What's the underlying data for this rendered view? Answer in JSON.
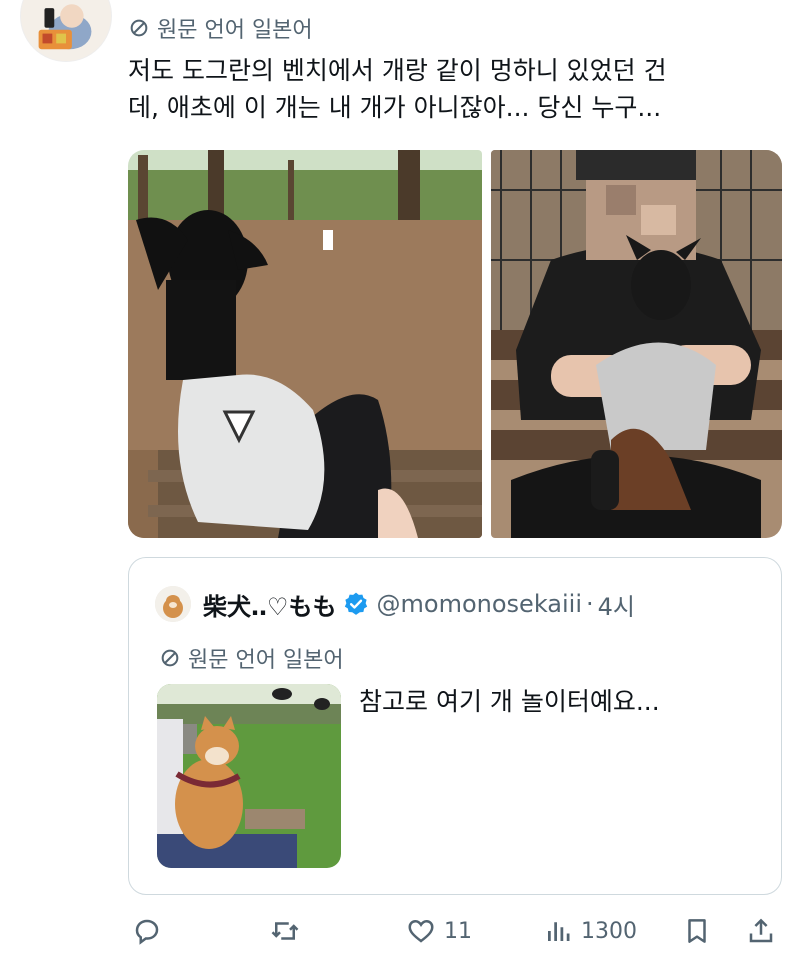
{
  "post": {
    "translate_label": "원문 언어 일본어",
    "text_lines": [
      "저도 도그란의 벤치에서 개랑 같이 멍하니 있었던 건",
      "데, 애초에 이 개는 내 개가 아니잖아... 당신 누구..."
    ]
  },
  "quote": {
    "name": "柴犬‥♡もも",
    "handle": "@momonosekaiii",
    "separator": "·",
    "time": "4시",
    "translate_label": "원문 언어 일본어",
    "text": "참고로 여기 개 놀이터예요..."
  },
  "actions": {
    "likes": "11",
    "views": "1300"
  },
  "icons": {
    "translate": "translate-icon",
    "verified": "verified-badge-icon",
    "reply": "reply-icon",
    "retweet": "retweet-icon",
    "like": "heart-icon",
    "views": "views-icon",
    "bookmark": "bookmark-icon",
    "share": "share-icon"
  },
  "colors": {
    "muted": "#536471",
    "verified": "#1d9bf0",
    "border": "#cfd9de"
  }
}
